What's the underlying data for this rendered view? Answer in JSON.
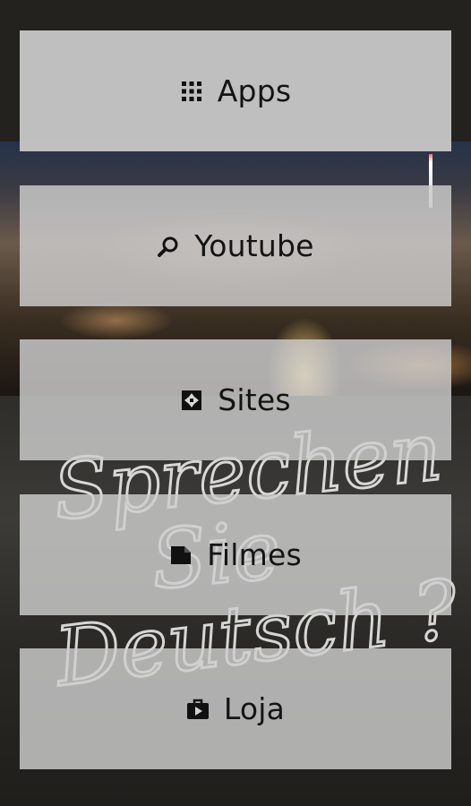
{
  "menu": {
    "items": [
      {
        "label": "Apps",
        "icon": "grid-icon"
      },
      {
        "label": "Youtube",
        "icon": "search-icon"
      },
      {
        "label": "Sites",
        "icon": "puzzle-icon"
      },
      {
        "label": "Filmes",
        "icon": "document-icon"
      },
      {
        "label": "Loja",
        "icon": "play-bag-icon"
      }
    ]
  },
  "background": {
    "handwriting_line1": "Sprechen",
    "handwriting_line2": "Sie",
    "handwriting_line3": "Deutsch ?"
  }
}
